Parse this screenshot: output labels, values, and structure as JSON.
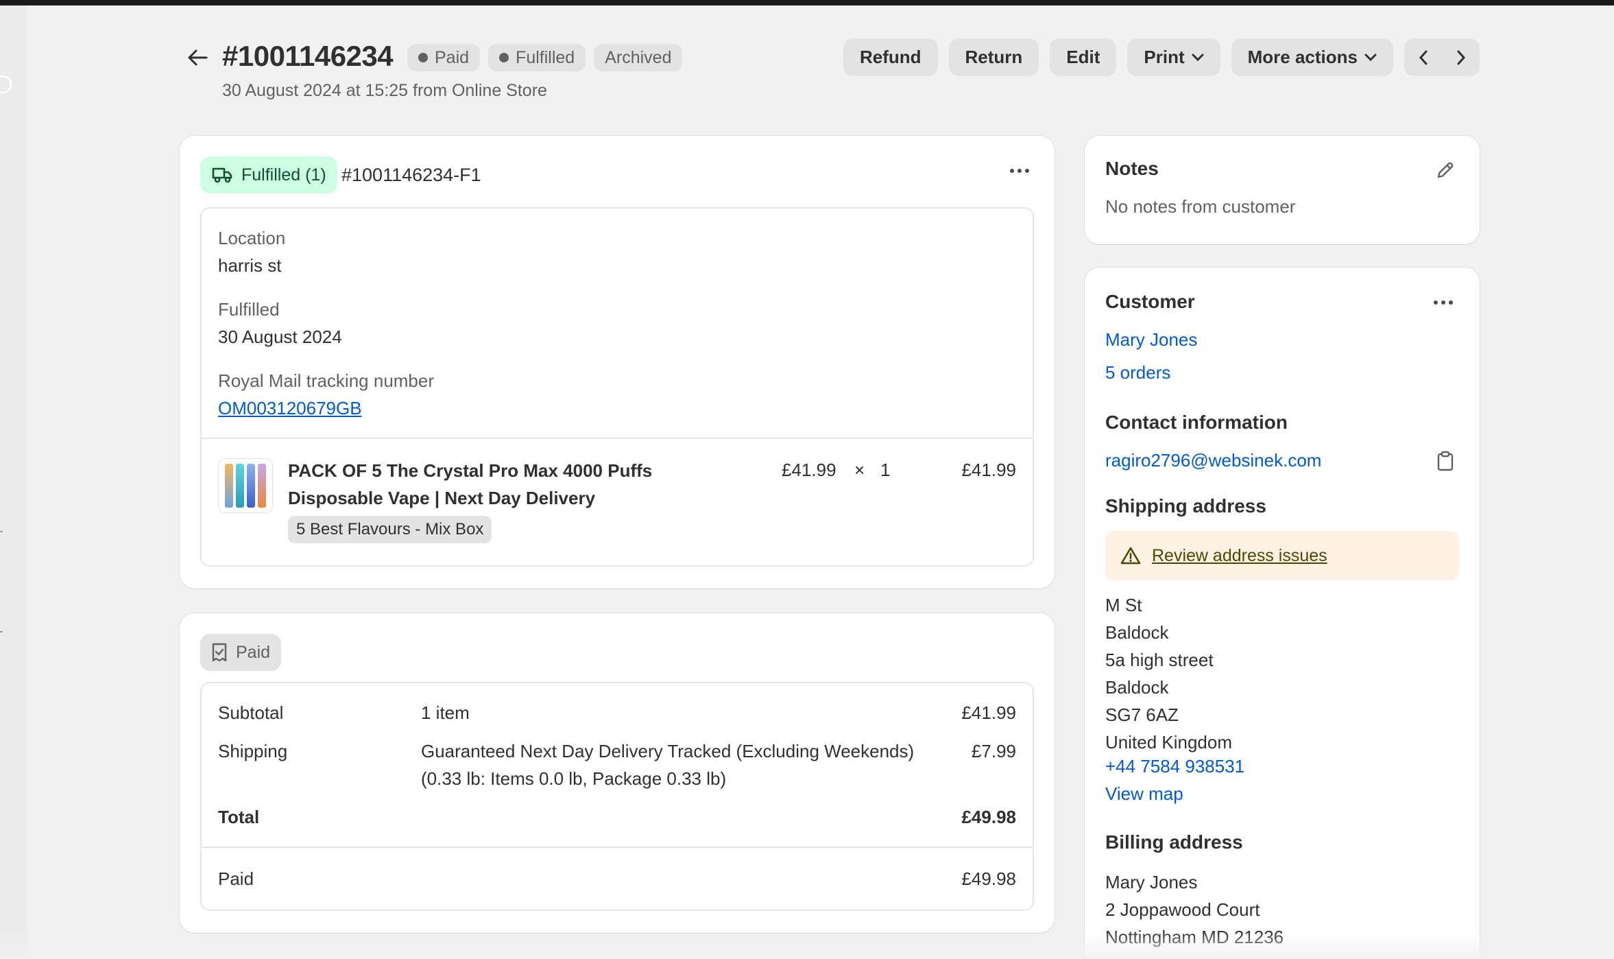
{
  "header": {
    "order_number": "#1001146234",
    "badges": [
      "Paid",
      "Fulfilled",
      "Archived"
    ],
    "subtitle": "30 August 2024 at 15:25 from Online Store",
    "actions": {
      "refund": "Refund",
      "return": "Return",
      "edit": "Edit",
      "print": "Print",
      "more_actions": "More actions"
    }
  },
  "fulfillment": {
    "badge": "Fulfilled (1)",
    "id": "#1001146234-F1",
    "location_label": "Location",
    "location_value": "harris st",
    "fulfilled_label": "Fulfilled",
    "fulfilled_value": "30 August 2024",
    "tracking_label": "Royal Mail tracking number",
    "tracking_value": "OM003120679GB",
    "item": {
      "title_line1": "PACK OF 5 The Crystal Pro Max 4000 Puffs",
      "title_line2": "Disposable Vape | Next Day Delivery",
      "variant": "5 Best Flavours - Mix Box",
      "price": "£41.99",
      "times": "×",
      "qty": "1",
      "total": "£41.99"
    }
  },
  "payment": {
    "badge": "Paid",
    "subtotal_label": "Subtotal",
    "subtotal_items": "1 item",
    "subtotal_value": "£41.99",
    "shipping_label": "Shipping",
    "shipping_line1": "Guaranteed Next Day Delivery Tracked (Excluding Weekends)",
    "shipping_line2": "(0.33 lb: Items 0.0 lb, Package 0.33 lb)",
    "shipping_value": "£7.99",
    "total_label": "Total",
    "total_value": "£49.98",
    "paid_label": "Paid",
    "paid_value": "£49.98"
  },
  "notes": {
    "title": "Notes",
    "text": "No notes from customer"
  },
  "customer": {
    "title": "Customer",
    "name": "Mary Jones",
    "orders": "5 orders",
    "contact_title": "Contact information",
    "email": "ragiro2796@websinek.com",
    "shipping_title": "Shipping address",
    "warning": "Review address issues",
    "shipping_lines": [
      "M St",
      "Baldock",
      "5a high street",
      "Baldock",
      "SG7 6AZ",
      "United Kingdom"
    ],
    "phone": "+44 7584 938531",
    "view_map": "View map",
    "billing_title": "Billing address",
    "billing_lines": [
      "Mary Jones",
      "2 Joppawood Court",
      "Nottingham MD 21236"
    ]
  },
  "colors": {
    "link": "#005bd3",
    "fulfilled_bg": "#cdfee1",
    "warning_bg": "#fff1e3",
    "badge_bg": "#e3e3e3"
  }
}
